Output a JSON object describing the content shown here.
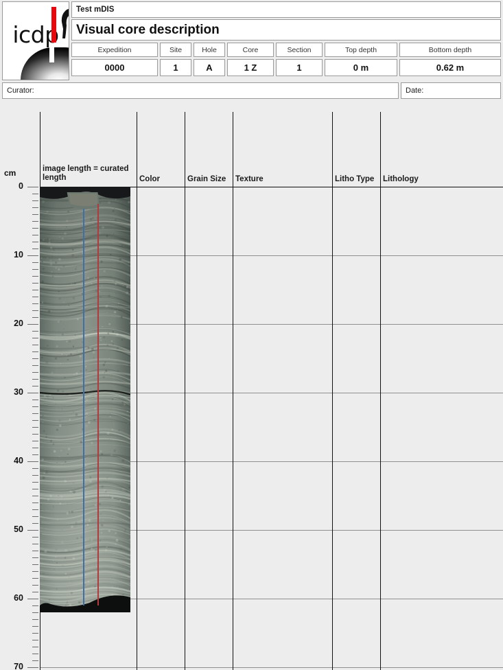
{
  "logo": {
    "left_word": "icdp",
    "right_word": "mdis",
    "alt": "icdp mdis logo"
  },
  "header": {
    "system_name": "Test mDIS",
    "form_title": "Visual core description",
    "fields": [
      {
        "label": "Expedition",
        "value": "0000"
      },
      {
        "label": "Site",
        "value": "1"
      },
      {
        "label": "Hole",
        "value": "A"
      },
      {
        "label": "Core",
        "value": "1 Z"
      },
      {
        "label": "Section",
        "value": "1"
      },
      {
        "label": "Top depth",
        "value": "0 m"
      },
      {
        "label": "Bottom depth",
        "value": "0.62 m"
      }
    ],
    "curator_label": "Curator:",
    "curator_value": "",
    "date_label": "Date:",
    "date_value": ""
  },
  "description_grid": {
    "depth_axis": {
      "unit": "cm",
      "major_ticks": [
        0,
        10,
        20,
        30,
        40,
        50,
        60,
        70
      ],
      "minor_tick_interval_cm": 1,
      "range_cm": [
        0,
        70
      ],
      "pixels_per_cm": 10
    },
    "columns": [
      {
        "name": "image-length",
        "label": "image length = curated length"
      },
      {
        "name": "color",
        "label": "Color"
      },
      {
        "name": "grain-size",
        "label": "Grain Size"
      },
      {
        "name": "texture",
        "label": "Texture"
      },
      {
        "name": "litho-type",
        "label": "Litho Type"
      },
      {
        "name": "lithology",
        "label": "Lithology"
      }
    ],
    "core_image": {
      "top_cm": 0,
      "bottom_cm": 62,
      "description": "split rock core photograph, grey-green laminated sediment",
      "overlay_lines": [
        {
          "name": "blue-line",
          "color": "#3f6fa8",
          "top_cm": 3.2,
          "bottom_cm": 61
        },
        {
          "name": "red-line",
          "color": "#b03a3c",
          "top_cm": 2.5,
          "bottom_cm": 61
        }
      ]
    },
    "row_values": {
      "color": [
        "",
        "",
        "",
        "",
        "",
        "",
        ""
      ],
      "grain_size": [
        "",
        "",
        "",
        "",
        "",
        "",
        ""
      ],
      "texture": [
        "",
        "",
        "",
        "",
        "",
        "",
        ""
      ],
      "litho_type": [
        "",
        "",
        "",
        "",
        "",
        "",
        ""
      ],
      "lithology": [
        "",
        "",
        "",
        "",
        "",
        "",
        ""
      ]
    }
  },
  "colors": {
    "page_background": "#ededed",
    "cell_background": "#ffffff",
    "border": "#9a9a9a",
    "grid_line": "#8f8f8f",
    "column_line": "#111111",
    "logo_red": "#e8070c"
  }
}
